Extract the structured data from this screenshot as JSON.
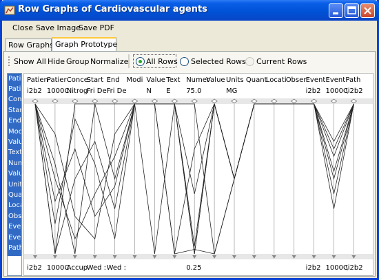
{
  "window": {
    "title": "Row Graphs of Cardiovascular agents"
  },
  "menu": {
    "items": [
      "Close",
      "Save Image",
      "Save PDF"
    ]
  },
  "tabs": [
    {
      "label": "Row Graphs",
      "active": false
    },
    {
      "label": "Graph Prototype",
      "active": true
    }
  ],
  "toolbar": {
    "show_all": "Show All",
    "hide": "Hide",
    "group": "Group",
    "normalize": "Normalize",
    "radio_all": "All Rows",
    "radio_selected": "Selected Rows",
    "radio_current": "Current Rows",
    "selected_radio": "All Rows"
  },
  "left_list": {
    "items": [
      "Patie",
      "Patie",
      "Conc",
      "Star",
      "End",
      "Mod",
      "Valu",
      "Text",
      "Num",
      "Valu",
      "Unit",
      "Qua",
      "Loca",
      "Obs",
      "Ever",
      "Ever",
      "Path"
    ]
  },
  "axes": {
    "headers": [
      "Patien",
      "Patier",
      "Conce",
      "Start",
      "End",
      "Modi",
      "Value",
      "Text",
      "Numer",
      "Value",
      "Units",
      "Quant",
      "Locati",
      "Obser",
      "Event",
      "Event",
      "Path"
    ],
    "top_values": [
      "i2b2",
      "1000C",
      "Nitrog",
      "Fri De",
      "Fri De",
      "",
      "N",
      "E",
      "75.0",
      "",
      "MG",
      "",
      "",
      "",
      "i2b2",
      "1000C",
      "\\i2b2"
    ],
    "bottom_values": [
      "i2b2",
      "1000C",
      "Accup",
      "Wed :",
      "Wed :",
      "",
      "",
      "",
      "0.25",
      "",
      "",
      "",
      "",
      "",
      "i2b2",
      "1000C",
      "\\i2b2"
    ]
  },
  "colors": {
    "accent": "#0842D4",
    "selection": "#316AC5",
    "radio_dot": "#2BA62B"
  }
}
